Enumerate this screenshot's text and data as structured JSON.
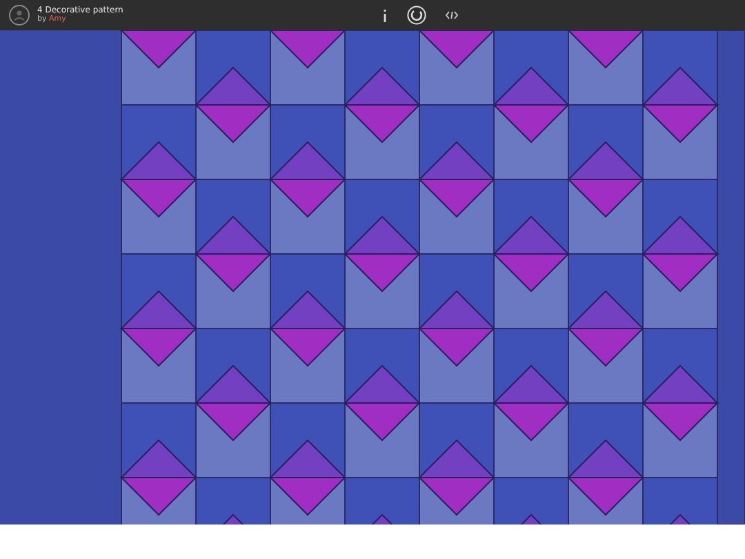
{
  "header": {
    "title": "4 Decorative pattern",
    "by": "by",
    "author": "Amy"
  }
}
